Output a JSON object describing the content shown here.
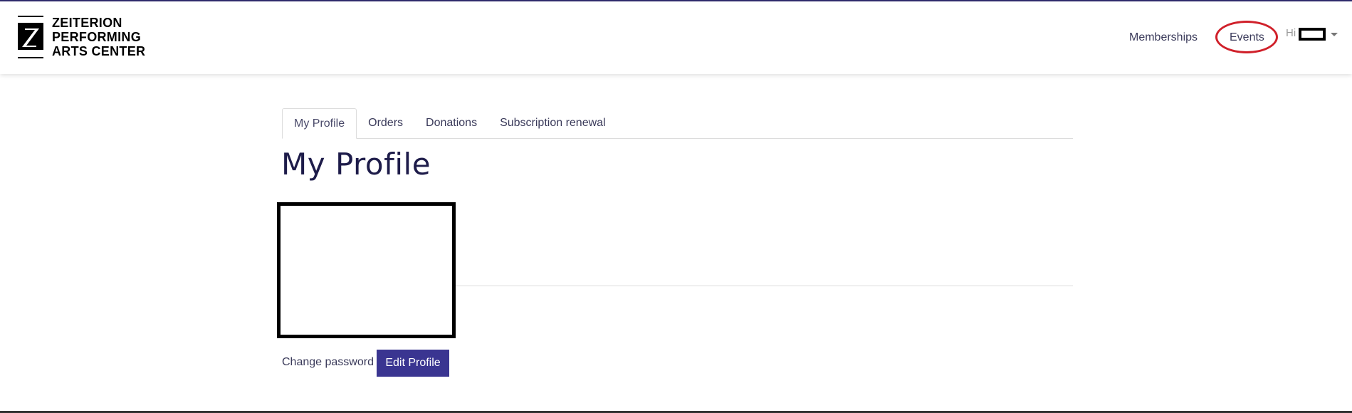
{
  "header": {
    "logo": {
      "line1": "ZEITERION",
      "line2": "PERFORMING",
      "line3": "ARTS CENTER"
    },
    "nav": {
      "memberships": "Memberships",
      "events": "Events"
    },
    "greeting": "Hi",
    "highlight_color": "#d0202a"
  },
  "tabs": [
    {
      "label": "My Profile",
      "active": true
    },
    {
      "label": "Orders",
      "active": false
    },
    {
      "label": "Donations",
      "active": false
    },
    {
      "label": "Subscription renewal",
      "active": false
    }
  ],
  "main": {
    "title": "My Profile",
    "change_password": "Change password",
    "edit_profile": "Edit Profile"
  },
  "colors": {
    "brand": "#3a3591",
    "accent_top": "#2f2b6e"
  },
  "icons": {
    "logo_mark": "z-logo-icon",
    "user_menu": "caret-down-icon"
  }
}
